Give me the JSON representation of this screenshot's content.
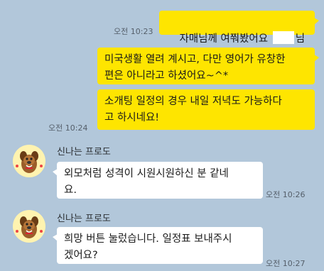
{
  "messages": [
    {
      "side": "me",
      "time": "오전 10:23",
      "text_a": "자매님께 여쭤봤어요 ",
      "text_b": "님~"
    },
    {
      "side": "me",
      "time": "",
      "text": "미국생활 열려 계시고, 다만 영어가 유창한\n편은 아니라고 하셨어요~^*"
    },
    {
      "side": "me",
      "time": "오전 10:24",
      "text": "소개팅 일정의 경우 내일 저녁도 가능하다\n고 하시네요!"
    },
    {
      "side": "them",
      "sender": "신나는 프로도",
      "time": "오전 10:26",
      "text": "외모처럼 성격이 시원시원하신 분 같네\n요."
    },
    {
      "side": "them",
      "sender": "신나는 프로도",
      "time": "오전 10:27",
      "text": "희망 버튼 눌렀습니다. 일정표 보내주시\n겠어요?"
    }
  ],
  "colors": {
    "background": "#b2c7da",
    "my_bubble": "#fee500",
    "their_bubble": "#ffffff"
  },
  "icons": {
    "avatar": "frodo-dog-icon"
  }
}
